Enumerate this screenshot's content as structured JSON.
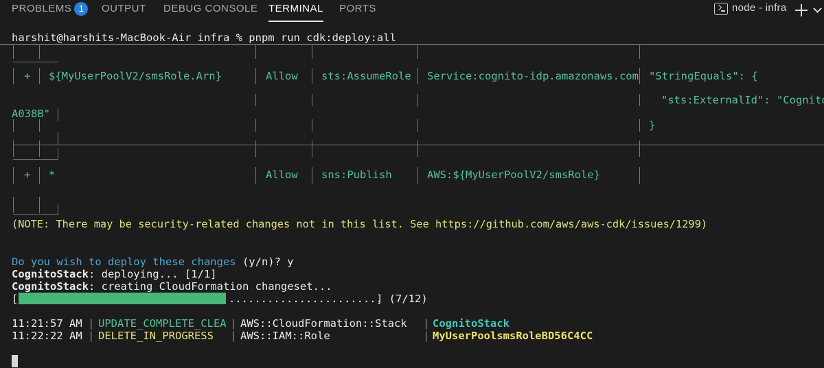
{
  "panel": {
    "tabs": [
      {
        "label": "PROBLEMS",
        "badge": "1"
      },
      {
        "label": "OUTPUT"
      },
      {
        "label": "DEBUG CONSOLE"
      },
      {
        "label": "TERMINAL",
        "active": true
      },
      {
        "label": "PORTS"
      }
    ],
    "terminal_name": "node - infra",
    "icons": [
      "terminal-icon",
      "plus-icon",
      "chevron-down-icon"
    ]
  },
  "terminal": {
    "prompt": "harshit@harshits-MacBook-Air infra % pnpm run cdk:deploy:all",
    "table": {
      "row1": {
        "sign": "+",
        "resource": "${MyUserPoolV2/smsRole.Arn}",
        "effect": "Allow",
        "action": "sts:AssumeRole",
        "principal": "Service:cognito-idp.amazonaws.com",
        "cond1": "\"StringEquals\": {",
        "cond2": "\"sts:ExternalId\": \"Cognito",
        "wrap": "A038B\"",
        "cond3": "}"
      },
      "row2": {
        "sign": "+",
        "resource": "*",
        "effect": "Allow",
        "action": "sns:Publish",
        "principal": "AWS:${MyUserPoolV2/smsRole}"
      }
    },
    "note": "(NOTE: There may be security-related changes not in this list. See https://github.com/aws/aws-cdk/issues/1299)",
    "question": "Do you wish to deploy these changes",
    "question_opts": " (y/n)? y",
    "stack": "CognitoStack",
    "deploying": ": deploying... [1/1]",
    "creating": ": creating CloudFormation changeset...",
    "progress": {
      "open": "[",
      "dots": "........................",
      "close": "] (7/12)",
      "fraction": 0.58
    },
    "events": [
      {
        "time": "11:21:57 AM",
        "status": "UPDATE_COMPLETE_CLEA",
        "type": "AWS::CloudFormation::Stack",
        "name": "CognitoStack"
      },
      {
        "time": "11:22:22 AM",
        "status": "DELETE_IN_PROGRESS",
        "type": "AWS::IAM::Role",
        "name": "MyUserPoolsmsRoleBD56C4CC"
      }
    ]
  },
  "colors": {
    "background": "#1c1c1c",
    "progress": "#48b775",
    "badge": "#2a7fd6"
  }
}
